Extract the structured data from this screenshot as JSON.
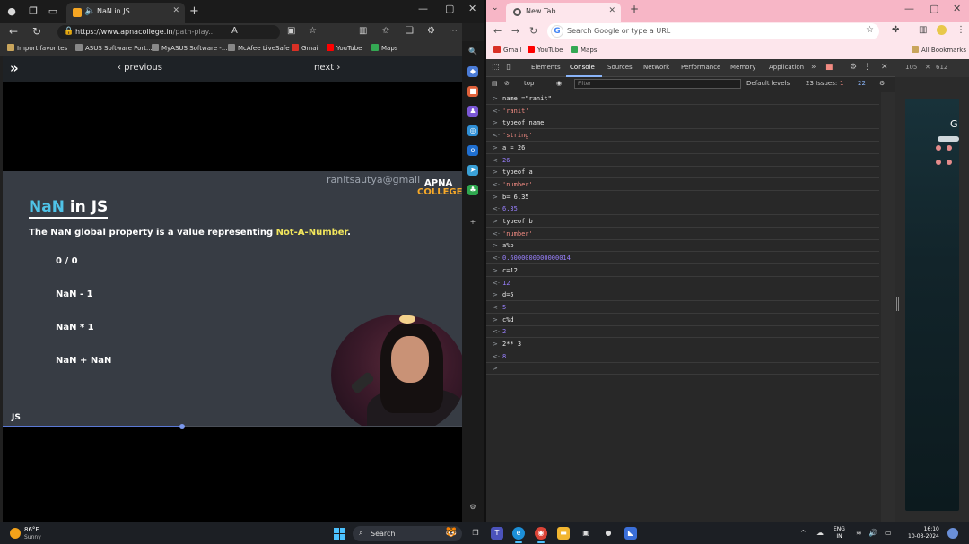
{
  "edge": {
    "tab_title": "NaN in JS",
    "url_host": "https://www.apnacollege.in",
    "url_path": "/path-play...",
    "bookmarks": [
      "Import favorites",
      "ASUS Software Port...",
      "MyASUS Software -...",
      "McAfee LiveSafe",
      "Gmail",
      "YouTube",
      "Maps"
    ]
  },
  "player": {
    "prev_label": "‹ previous",
    "next_label": "next ›",
    "progress_fraction": 0.39
  },
  "slide": {
    "email": "ranitsautya@gmail",
    "logo_line1": "APNA",
    "logo_line2": "COLLEGE",
    "title_highlight": "NaN",
    "title_rest": " in JS",
    "desc_prefix": "The NaN global property is a value representing ",
    "desc_highlight": "Not-A-Number",
    "desc_suffix": ".",
    "examples": [
      "0 / 0",
      "NaN - 1",
      "NaN * 1",
      "NaN + NaN"
    ],
    "section_label": "JS"
  },
  "chrome": {
    "tab_title": "New Tab",
    "omnibox_placeholder": "Search Google or type a URL",
    "bookmarks": [
      "Gmail",
      "YouTube",
      "Maps"
    ],
    "all_bookmarks": "All Bookmarks"
  },
  "devtools": {
    "tabs": [
      "Elements",
      "Console",
      "Sources",
      "Network",
      "Performance",
      "Memory",
      "Application"
    ],
    "context": "top",
    "filter_placeholder": "Filter",
    "levels": "Default levels",
    "issues": "23 Issues:",
    "issues_err": "1",
    "issues_info": "22",
    "side_tabs": [
      "105",
      "612"
    ],
    "console": [
      {
        "dir": "in",
        "text": "name =\"ranit\""
      },
      {
        "dir": "out",
        "kind": "str",
        "text": "'ranit'"
      },
      {
        "dir": "in",
        "text": "typeof name"
      },
      {
        "dir": "out",
        "kind": "str",
        "text": "'string'"
      },
      {
        "dir": "in",
        "text": "a = 26"
      },
      {
        "dir": "out",
        "kind": "num",
        "text": "26"
      },
      {
        "dir": "in",
        "text": "typeof a"
      },
      {
        "dir": "out",
        "kind": "str",
        "text": "'number'"
      },
      {
        "dir": "in",
        "text": "b= 6.35"
      },
      {
        "dir": "out",
        "kind": "num",
        "text": "6.35"
      },
      {
        "dir": "in",
        "text": "typeof b"
      },
      {
        "dir": "out",
        "kind": "str",
        "text": "'number'"
      },
      {
        "dir": "in",
        "text": "a%b"
      },
      {
        "dir": "out",
        "kind": "num",
        "text": "0.6000000000000014"
      },
      {
        "dir": "in",
        "text": "c=12"
      },
      {
        "dir": "out",
        "kind": "num",
        "text": "12"
      },
      {
        "dir": "in",
        "text": "d=5"
      },
      {
        "dir": "out",
        "kind": "num",
        "text": "5"
      },
      {
        "dir": "in",
        "text": "c%d"
      },
      {
        "dir": "out",
        "kind": "num",
        "text": "2"
      },
      {
        "dir": "in",
        "text": "2** 3"
      },
      {
        "dir": "out",
        "kind": "num",
        "text": "8"
      },
      {
        "dir": "prompt",
        "text": ""
      }
    ]
  },
  "taskbar": {
    "temp": "86°F",
    "condition": "Sunny",
    "search_label": "Search",
    "lang1": "ENG",
    "lang2": "IN",
    "time": "16:10",
    "date": "10-03-2024"
  }
}
